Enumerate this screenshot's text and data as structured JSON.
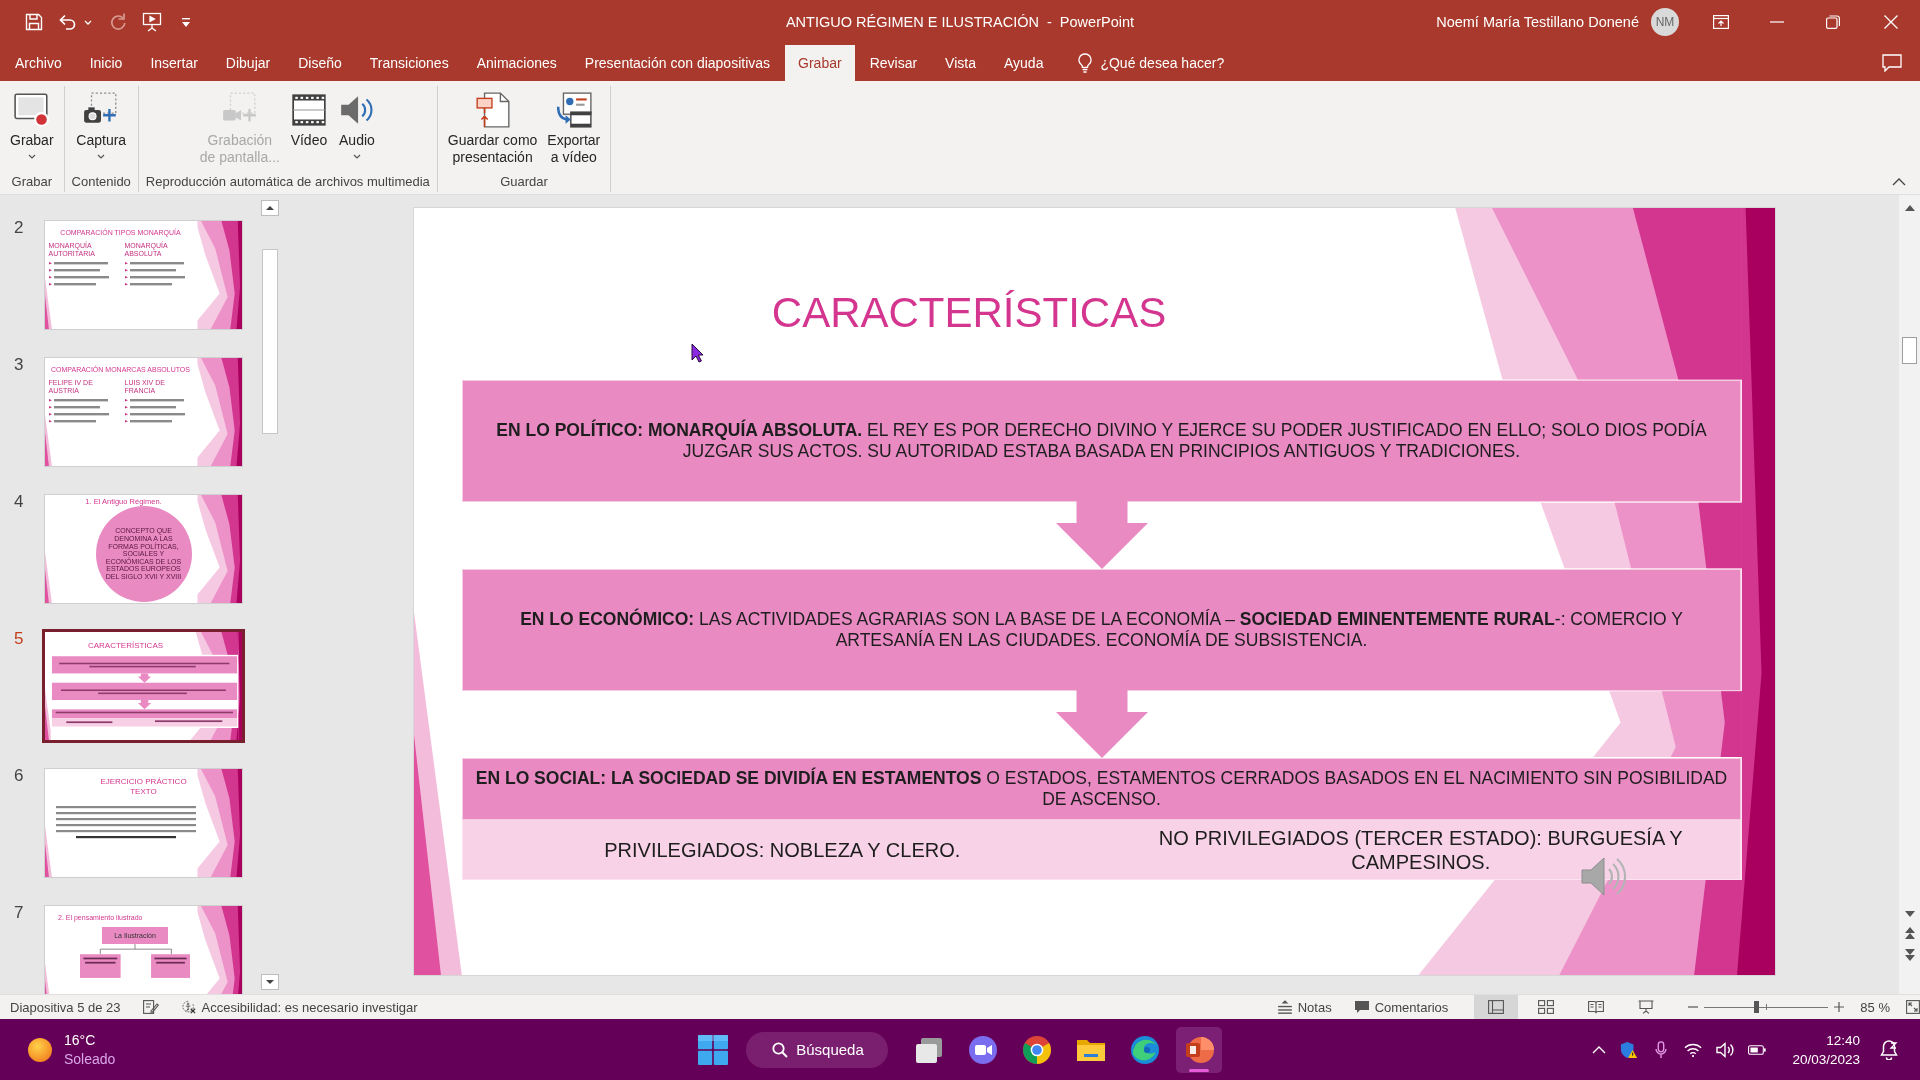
{
  "window": {
    "title": "ANTIGUO RÉGIMEN E ILUSTRACIÓN  -  PowerPoint",
    "user": "Noemí María Testillano Donené",
    "avatar": "NM"
  },
  "quick_access": [
    {
      "kind": "save",
      "disabled": false,
      "dropdown": false
    },
    {
      "kind": "undo",
      "disabled": false,
      "dropdown": true
    },
    {
      "kind": "redo",
      "disabled": true,
      "dropdown": false
    },
    {
      "kind": "start_show",
      "disabled": false,
      "dropdown": false
    },
    {
      "kind": "customize",
      "disabled": false,
      "dropdown": false
    }
  ],
  "tabs": [
    {
      "label": "Archivo",
      "selected": false
    },
    {
      "label": "Inicio",
      "selected": false
    },
    {
      "label": "Insertar",
      "selected": false
    },
    {
      "label": "Dibujar",
      "selected": false
    },
    {
      "label": "Diseño",
      "selected": false
    },
    {
      "label": "Transiciones",
      "selected": false
    },
    {
      "label": "Animaciones",
      "selected": false
    },
    {
      "label": "Presentación con diapositivas",
      "selected": false
    },
    {
      "label": "Grabar",
      "selected": true
    },
    {
      "label": "Revisar",
      "selected": false
    },
    {
      "label": "Vista",
      "selected": false
    },
    {
      "label": "Ayuda",
      "selected": false
    }
  ],
  "tell_me": {
    "placeholder": "¿Qué desea hacer?"
  },
  "ribbon": {
    "groups": [
      {
        "label": "Grabar",
        "buttons": [
          {
            "kind": "record",
            "lines": [
              "Grabar"
            ],
            "dropdown": true,
            "disabled": false
          }
        ]
      },
      {
        "label": "Contenido",
        "buttons": [
          {
            "kind": "screenshot",
            "lines": [
              "Captura"
            ],
            "dropdown": true,
            "disabled": false
          }
        ]
      },
      {
        "label": "Reproducción automática de archivos multimedia",
        "buttons": [
          {
            "kind": "screen_recording",
            "lines": [
              "Grabación",
              "de pantalla..."
            ],
            "dropdown": false,
            "disabled": true
          },
          {
            "kind": "video",
            "lines": [
              "Vídeo"
            ],
            "dropdown": false,
            "disabled": false
          },
          {
            "kind": "audio",
            "lines": [
              "Audio"
            ],
            "dropdown": true,
            "disabled": false
          }
        ]
      },
      {
        "label": "Guardar",
        "buttons": [
          {
            "kind": "save_as_show",
            "lines": [
              "Guardar como",
              "presentación"
            ],
            "dropdown": false,
            "disabled": false
          },
          {
            "kind": "export_video",
            "lines": [
              "Exportar",
              "a vídeo"
            ],
            "dropdown": false,
            "disabled": false
          }
        ]
      }
    ]
  },
  "thumbnails": [
    {
      "number": "2",
      "kind": "columns",
      "title": "COMPARACIÓN TIPOS MONARQUÍA",
      "columns": [
        "MONARQUÍA AUTORITARIA",
        "MONARQUÍA ABSOLUTA"
      ],
      "selected": false
    },
    {
      "number": "3",
      "kind": "columns",
      "title": "COMPARACIÓN MONARCAS ABSOLUTOS",
      "columns": [
        "FELIPE IV DE AUSTRIA",
        "LUIS XIV DE FRANCIA"
      ],
      "selected": false
    },
    {
      "number": "4",
      "kind": "circle",
      "title": "1. El Antiguo Régimen.",
      "circle_text": "CONCEPTO QUE DENOMINA A LAS FORMAS POLÍTICAS, SOCIALES Y ECONÓMICAS DE LOS ESTADOS EUROPEOS DEL SIGLO XVII Y XVIII",
      "selected": false
    },
    {
      "number": "5",
      "kind": "flow",
      "title": "CARACTERÍSTICAS",
      "selected": true
    },
    {
      "number": "6",
      "kind": "text",
      "title": "EJERCICIO PRÁCTICO TEXTO",
      "selected": false
    },
    {
      "number": "7",
      "kind": "diagram",
      "title": "2. El pensamiento ilustrado",
      "box": "La Ilustración",
      "selected": false
    }
  ],
  "slide": {
    "title": "CARACTERÍSTICAS",
    "blocks": [
      {
        "text": "**EN LO POLÍTICO: MONARQUÍA ABSOLUTA.** EL REY ES POR DERECHO DIVINO Y EJERCE SU PODER JUSTIFICADO EN ELLO; SOLO DIOS PODÍA JUZGAR SUS ACTOS. SU AUTORIDAD ESTABA BASADA EN PRINCIPIOS ANTIGUOS Y TRADICIONES."
      },
      {
        "text": "**EN LO ECONÓMICO:** LAS ACTIVIDADES AGRARIAS SON LA BASE DE LA ECONOMÍA – **SOCIEDAD EMINENTEMENTE RURAL**-: COMERCIO Y ARTESANÍA EN LAS CIUDADES. ECONOMÍA DE SUBSISTENCIA."
      },
      {
        "text": "**EN LO SOCIAL: LA SOCIEDAD SE DIVIDÍA EN ESTAMENTOS** O ESTADOS, ESTAMENTOS CERRADOS BASADOS EN EL NACIMIENTO SIN POSIBILIDAD DE ASCENSO.",
        "cells": [
          "PRIVILEGIADOS: NOBLEZA Y CLERO.",
          "NO PRIVILEGIADOS (TERCER ESTADO): BURGUESÍA Y CAMPESINOS."
        ]
      }
    ]
  },
  "status_bar": {
    "slide_info": "Diapositiva 5 de 23",
    "accessibility": "Accesibilidad: es necesario investigar",
    "notes": "Notas",
    "comments": "Comentarios",
    "views": [
      {
        "kind": "normal",
        "selected": true
      },
      {
        "kind": "sorter",
        "selected": false
      },
      {
        "kind": "reading",
        "selected": false
      },
      {
        "kind": "slideshow",
        "selected": false
      }
    ],
    "zoom": {
      "level": 0.42,
      "value": "85 %"
    }
  },
  "taskbar": {
    "weather": {
      "temperature": "16°C",
      "condition": "Soleado"
    },
    "search": "Búsqueda",
    "apps": [
      {
        "kind": "task_view",
        "active": false
      },
      {
        "kind": "video_call",
        "active": false
      },
      {
        "kind": "chrome",
        "active": false
      },
      {
        "kind": "explorer",
        "active": false
      },
      {
        "kind": "edge",
        "active": false
      },
      {
        "kind": "powerpoint",
        "active": true
      }
    ],
    "time": "12:40",
    "date": "20/03/2023"
  }
}
